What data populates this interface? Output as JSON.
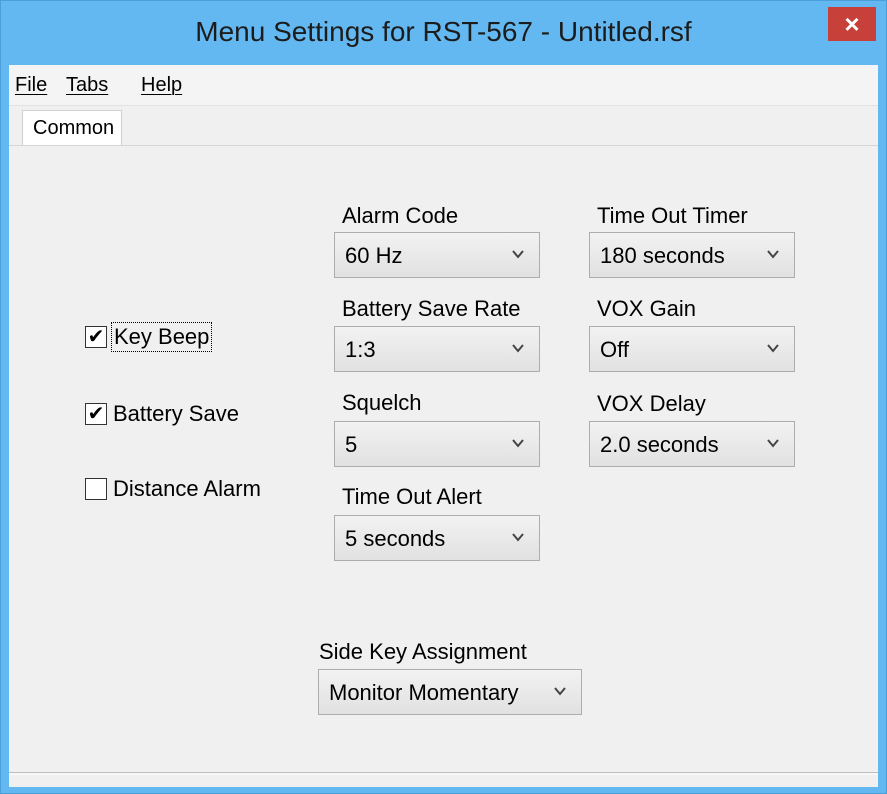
{
  "window": {
    "title": "Menu Settings for RST-567 - Untitled.rsf",
    "close_glyph": "×"
  },
  "menu": [
    "File",
    "Tabs",
    "Help"
  ],
  "tabs": [
    {
      "label": "Common",
      "selected": true
    }
  ],
  "checkboxes": [
    {
      "label": "Key Beep",
      "checked": true,
      "check_glyph": "✔"
    },
    {
      "label": "Battery Save",
      "checked": true,
      "check_glyph": "✔"
    },
    {
      "label": "Distance Alarm",
      "checked": false,
      "check_glyph": ""
    }
  ],
  "fields": {
    "alarm_code": {
      "label": "Alarm Code",
      "value": "60 Hz"
    },
    "battery_save_rate": {
      "label": "Battery Save Rate",
      "value": "1:3"
    },
    "squelch": {
      "label": "Squelch",
      "value": "5"
    },
    "time_out_alert": {
      "label": "Time Out Alert",
      "value": "5 seconds"
    },
    "time_out_timer": {
      "label": "Time Out Timer",
      "value": "180 seconds"
    },
    "vox_gain": {
      "label": "VOX Gain",
      "value": "Off"
    },
    "vox_delay": {
      "label": "VOX Delay",
      "value": "2.0 seconds"
    },
    "side_key_assignment": {
      "label": "Side Key Assignment",
      "value": "Monitor Momentary"
    }
  },
  "icons": {
    "dropdown": "chevron-down-icon",
    "close": "close-icon",
    "check": "checkmark-icon"
  },
  "colors": {
    "titlebar": "#63b8f1",
    "close_button": "#c7403a",
    "client": "#f0f0f0"
  }
}
